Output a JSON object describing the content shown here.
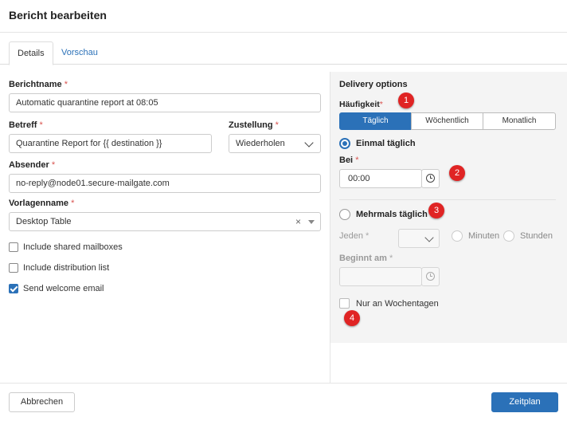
{
  "dialog": {
    "title": "Bericht bearbeiten"
  },
  "tabs": [
    {
      "label": "Details",
      "active": true
    },
    {
      "label": "Vorschau",
      "active": false
    }
  ],
  "form": {
    "report_name": {
      "label": "Berichtname",
      "value": "Automatic quarantine report at 08:05"
    },
    "subject": {
      "label": "Betreff",
      "value": "Quarantine Report for {{ destination }}"
    },
    "delivery": {
      "label": "Zustellung",
      "value": "Wiederholen"
    },
    "sender": {
      "label": "Absender",
      "value": "no-reply@node01.secure-mailgate.com"
    },
    "template": {
      "label": "Vorlagenname",
      "value": "Desktop Table",
      "clear_symbol": "×"
    },
    "required_mark": "*",
    "checkboxes": [
      {
        "label": "Include shared mailboxes",
        "checked": false
      },
      {
        "label": "Include distribution list",
        "checked": false
      },
      {
        "label": "Send welcome email",
        "checked": true
      }
    ]
  },
  "delivery_options": {
    "heading": "Delivery options",
    "frequency": {
      "label": "Häufigkeit",
      "options": [
        {
          "label": "Täglich",
          "active": true
        },
        {
          "label": "Wöchentlich",
          "active": false
        },
        {
          "label": "Monatlich",
          "active": false
        }
      ]
    },
    "once_daily": {
      "label": "Einmal täglich",
      "selected": true
    },
    "at": {
      "label": "Bei",
      "value": "00:00"
    },
    "multiple_daily": {
      "label": "Mehrmals täglich",
      "selected": false
    },
    "every": {
      "label": "Jeden",
      "value": ""
    },
    "unit_minutes": "Minuten",
    "unit_hours": "Stunden",
    "start_at": {
      "label": "Beginnt am",
      "value": ""
    },
    "weekdays_only": {
      "label": "Nur an Wochentagen",
      "checked": false
    }
  },
  "markers": [
    "1",
    "2",
    "3",
    "4"
  ],
  "footer": {
    "cancel_label": "Abbrechen",
    "submit_label": "Zeitplan"
  },
  "colors": {
    "primary": "#2b71b8",
    "required": "#d9534f",
    "marker": "#e02424"
  }
}
